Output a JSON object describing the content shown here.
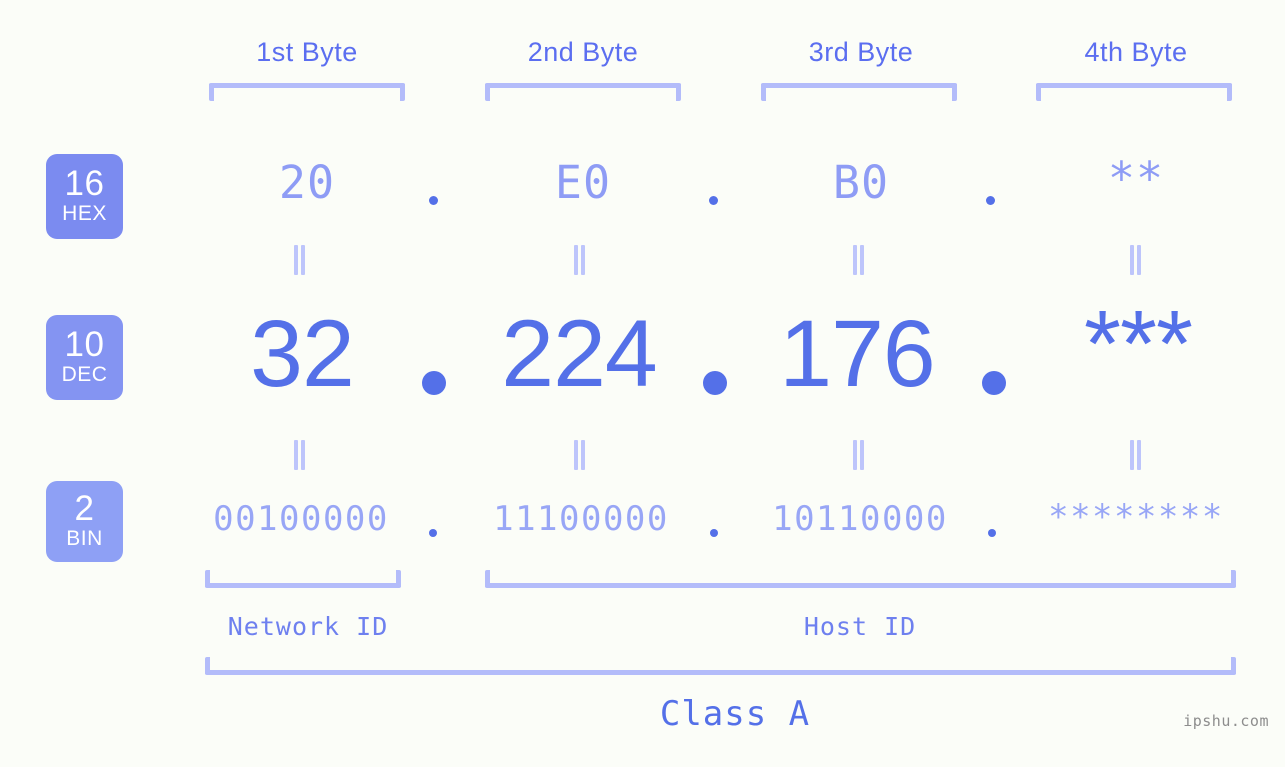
{
  "watermark": "ipshu.com",
  "byte_headers": [
    {
      "label": "1st Byte"
    },
    {
      "label": "2nd Byte"
    },
    {
      "label": "3rd Byte"
    },
    {
      "label": "4th Byte"
    }
  ],
  "radix_badges": [
    {
      "number": "16",
      "name": "HEX",
      "color": "#7b8bf0"
    },
    {
      "number": "10",
      "name": "DEC",
      "color": "#8494f2"
    },
    {
      "number": "2",
      "name": "BIN",
      "color": "#8ea0f5"
    }
  ],
  "rows": {
    "hex": {
      "radix": "16",
      "radix_name": "HEX",
      "values": [
        "20",
        "E0",
        "B0",
        "**"
      ]
    },
    "dec": {
      "radix": "10",
      "radix_name": "DEC",
      "values": [
        "32",
        "224",
        "176",
        "***"
      ]
    },
    "bin": {
      "radix": "2",
      "radix_name": "BIN",
      "values": [
        "00100000",
        "11100000",
        "10110000",
        "********"
      ]
    }
  },
  "separator": ".",
  "equals_mark": "=",
  "id_ranges": [
    {
      "label": "Network ID"
    },
    {
      "label": "Host ID"
    }
  ],
  "address_class": {
    "label": "Class A"
  },
  "colors": {
    "background": "#fbfdf8",
    "accent_strong": "#5470e8",
    "accent_mid": "#8e9cf5",
    "accent_light": "#b3bcfa",
    "badge_hex": "#7b8bf0",
    "badge_dec": "#8494f2",
    "badge_bin": "#8ea0f5",
    "watermark": "#8d8d8d"
  }
}
